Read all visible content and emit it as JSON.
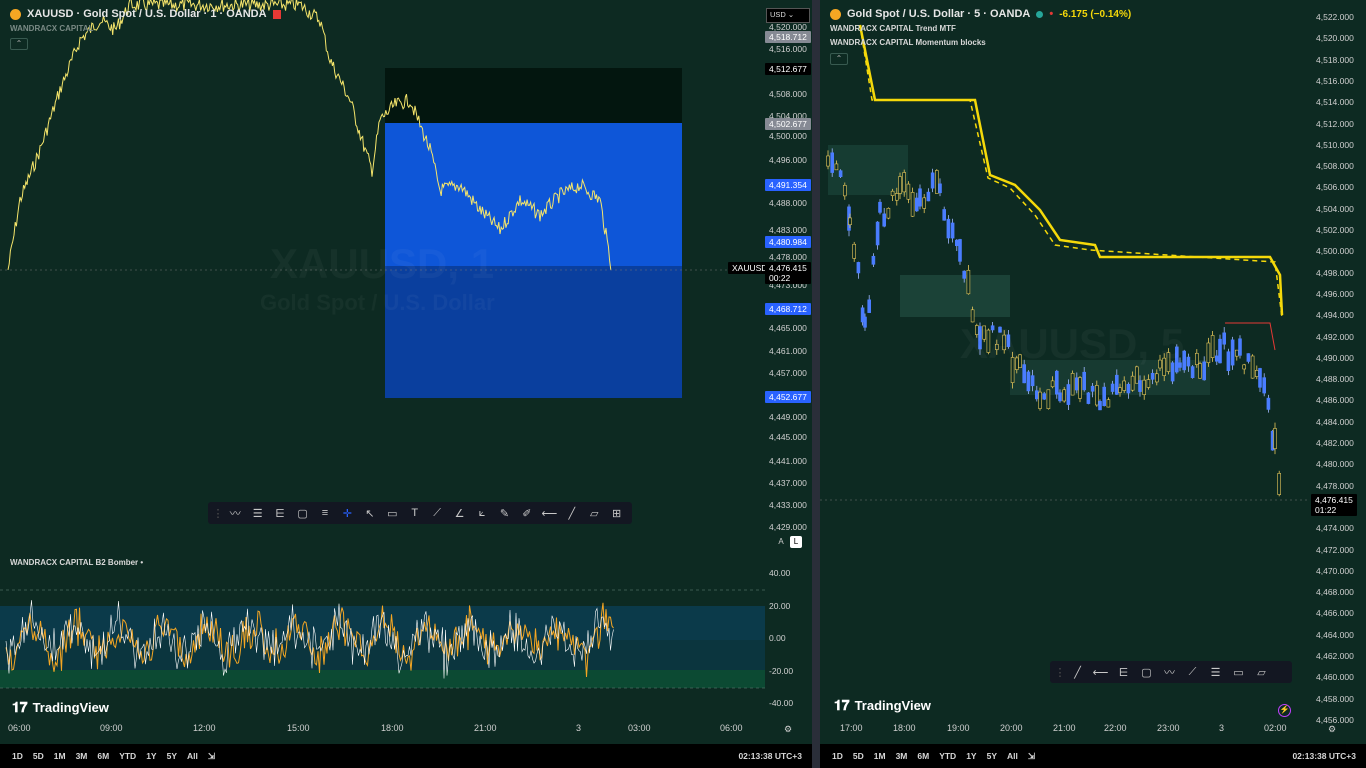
{
  "left": {
    "symbol": "XAUUSD · Gold Spot / U.S. Dollar · 1 · OANDA",
    "indicator_top": "WANDRACX CAPITAL",
    "currency": "USD",
    "watermark_main": "XAUUSD, 1",
    "watermark_sub": "Gold Spot / U.S. Dollar",
    "price_axis": [
      "4,520.000",
      "4,516.000",
      "4,508.000",
      "4,504.000",
      "4,500.000",
      "4,496.000",
      "4,488.000",
      "4,483.000",
      "4,478.000",
      "4,473.000",
      "4,465.000",
      "4,461.000",
      "4,457.000",
      "4,449.000",
      "4,445.000",
      "4,441.000",
      "4,437.000",
      "4,433.000",
      "4,429.000"
    ],
    "tags": {
      "t1": "4,518.712",
      "t2": "4,512.677",
      "t3": "4,502.677",
      "t4": "4,491.354",
      "t5": "4,480.984",
      "t6": "4,468.712",
      "t7": "4,452.677",
      "current_symbol": "XAUUSD",
      "current_price": "4,476.415",
      "current_timer": "00:22"
    },
    "oscillator_label": "WANDRACX CAPITAL B2 Bomber",
    "osc_axis": [
      "40.00",
      "20.00",
      "0.00",
      "-20.00",
      "-40.00"
    ],
    "time_axis": [
      "06:00",
      "09:00",
      "12:00",
      "15:00",
      "18:00",
      "21:00",
      "3",
      "03:00",
      "06:00"
    ],
    "toggle_a": "A",
    "toggle_l": "L",
    "brand": "TradingView"
  },
  "right": {
    "symbol": "Gold Spot / U.S. Dollar · 5 · OANDA",
    "change": "-6.175 (−0.14%)",
    "indicator_1": "WANDRACX CAPITAL Trend MTF",
    "indicator_2": "WANDRACX CAPITAL Momentum blocks",
    "watermark_main": "XAUUSD, 5",
    "price_axis": [
      "4,522.000",
      "4,520.000",
      "4,518.000",
      "4,516.000",
      "4,514.000",
      "4,512.000",
      "4,510.000",
      "4,508.000",
      "4,506.000",
      "4,504.000",
      "4,502.000",
      "4,500.000",
      "4,498.000",
      "4,496.000",
      "4,494.000",
      "4,492.000",
      "4,490.000",
      "4,488.000",
      "4,486.000",
      "4,484.000",
      "4,482.000",
      "4,480.000",
      "4,478.000",
      "4,476.000",
      "4,474.000",
      "4,472.000",
      "4,470.000",
      "4,468.000",
      "4,466.000",
      "4,464.000",
      "4,462.000",
      "4,460.000",
      "4,458.000",
      "4,456.000"
    ],
    "current_price": "4,476.415",
    "current_timer": "01:22",
    "time_axis": [
      "17:00",
      "18:00",
      "19:00",
      "20:00",
      "21:00",
      "22:00",
      "23:00",
      "3",
      "02:00"
    ],
    "brand": "TradingView"
  },
  "bottom": {
    "ranges": [
      "1D",
      "5D",
      "1M",
      "3M",
      "6M",
      "YTD",
      "1Y",
      "5Y",
      "All"
    ],
    "clock": "02:13:38 UTC+3"
  },
  "colors": {
    "bg": "#0d2a22",
    "price_line": "#f5e56b",
    "blue_zone": "#1a5fe0",
    "trend_line": "#f5d90a",
    "accent": "#2962ff"
  }
}
